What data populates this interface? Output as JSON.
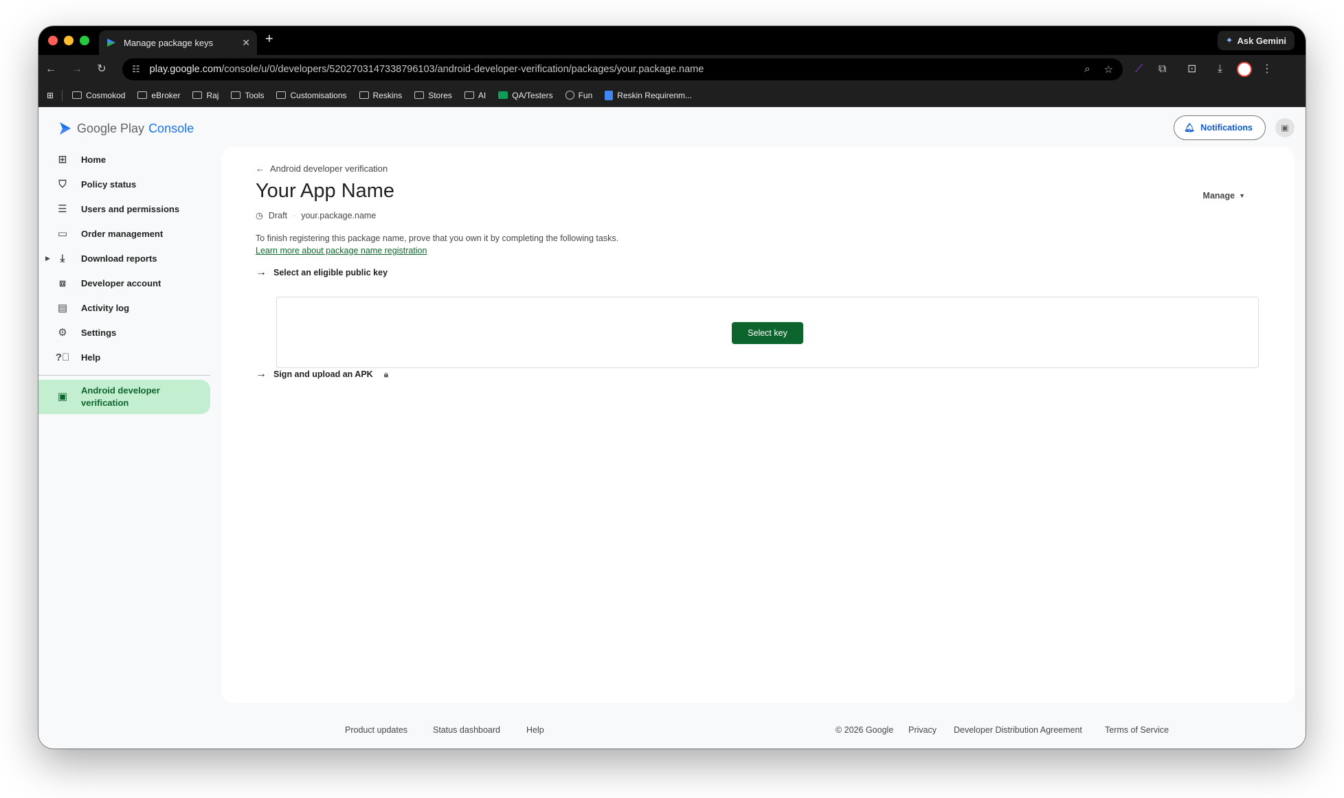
{
  "browser": {
    "tab_title": "Manage package keys",
    "new_tab": "+",
    "ask_gemini": "Ask Gemini",
    "url_host": "play.google.com",
    "url_path": "/console/u/0/developers/5202703147338796103/android-developer-verification/packages/your.package.name",
    "bookmarks": [
      "Cosmokod",
      "eBroker",
      "Raj",
      "Tools",
      "Customisations",
      "Reskins",
      "Stores",
      "AI",
      "QA/Testers",
      "Fun",
      "Reskin Requirenm..."
    ]
  },
  "header": {
    "logo_google_play": "Google Play",
    "logo_console": "Console",
    "notifications": "Notifications"
  },
  "sidebar": {
    "items": [
      {
        "label": "Home",
        "icon": "grid-icon"
      },
      {
        "label": "Policy status",
        "icon": "shield-icon"
      },
      {
        "label": "Users and permissions",
        "icon": "users-icon"
      },
      {
        "label": "Order management",
        "icon": "card-icon"
      },
      {
        "label": "Download reports",
        "icon": "download-icon"
      },
      {
        "label": "Developer account",
        "icon": "id-badge-icon"
      },
      {
        "label": "Activity log",
        "icon": "document-icon"
      },
      {
        "label": "Settings",
        "icon": "gear-icon"
      },
      {
        "label": "Help",
        "icon": "help-icon"
      }
    ],
    "active_label": "Android developer verification"
  },
  "main": {
    "back_label": "Android developer verification",
    "app_name": "Your App Name",
    "status": "Draft",
    "package_name": "your.package.name",
    "manage": "Manage",
    "intro": "To finish registering this package name, prove that you own it by completing the following tasks.",
    "learn_more": "Learn more about package name registration",
    "task1": "Select an eligible public key",
    "select_key": "Select key",
    "task2": "Sign and upload an APK"
  },
  "footer": {
    "product_updates": "Product updates",
    "status_dashboard": "Status dashboard",
    "help": "Help",
    "copyright": "© 2026 Google",
    "privacy": "Privacy",
    "dda": "Developer Distribution Agreement",
    "tos": "Terms of Service"
  },
  "colors": {
    "brand_green": "#0d652d",
    "active_nav_bg": "#c4eed0",
    "link_blue": "#0b57d0"
  }
}
